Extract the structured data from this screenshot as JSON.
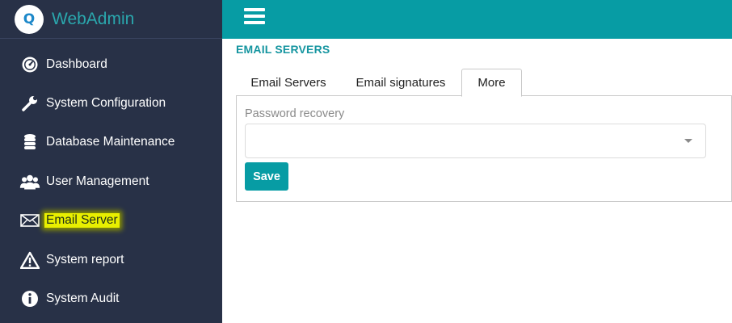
{
  "app": {
    "logo_letter": "Q",
    "title": "WebAdmin"
  },
  "colors": {
    "teal": "#079ca4",
    "sidebar": "#283147",
    "highlight": "#e8ef00"
  },
  "sidebar": {
    "items": [
      {
        "label": "Dashboard",
        "icon": "dashboard-gauge-icon"
      },
      {
        "label": "System Configuration",
        "icon": "wrench-icon"
      },
      {
        "label": "Database Maintenance",
        "icon": "database-icon"
      },
      {
        "label": "User Management",
        "icon": "users-icon"
      },
      {
        "label": "Email Server",
        "icon": "envelope-icon",
        "active": true
      },
      {
        "label": "System report",
        "icon": "warning-triangle-icon"
      },
      {
        "label": "System Audit",
        "icon": "info-circle-icon"
      }
    ]
  },
  "header": {
    "menu_icon": "hamburger-menu-icon"
  },
  "main": {
    "title": "EMAIL SERVERS",
    "tabs": [
      {
        "label": "Email Servers"
      },
      {
        "label": "Email signatures"
      },
      {
        "label": "More",
        "active": true
      }
    ],
    "form": {
      "field_label": "Password recovery",
      "select_value": "",
      "save_label": "Save"
    }
  }
}
